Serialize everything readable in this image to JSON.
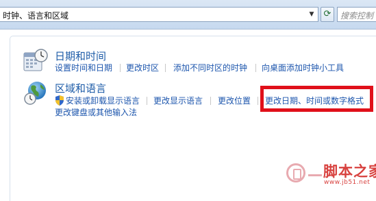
{
  "address_bar": {
    "path": "时钟、语言和区域",
    "search_placeholder": "搜索控制"
  },
  "categories": [
    {
      "title": "日期和时间",
      "icon": "clock-calendar-icon",
      "links": [
        "设置时间和日期",
        "更改时区",
        "添加不同时区的时钟",
        "向桌面添加时钟小工具"
      ]
    },
    {
      "title": "区域和语言",
      "icon": "globe-clock-icon",
      "links": [
        "安装或卸载显示语言",
        "更改显示语言",
        "更改位置",
        "更改日期、时间或数字格式",
        "更改键盘或其他输入法"
      ]
    }
  ],
  "highlight_color": "#e0101a",
  "link_color": "#1d56ad",
  "watermark": {
    "title": "脚本之家",
    "url": "www.jb51.net"
  }
}
